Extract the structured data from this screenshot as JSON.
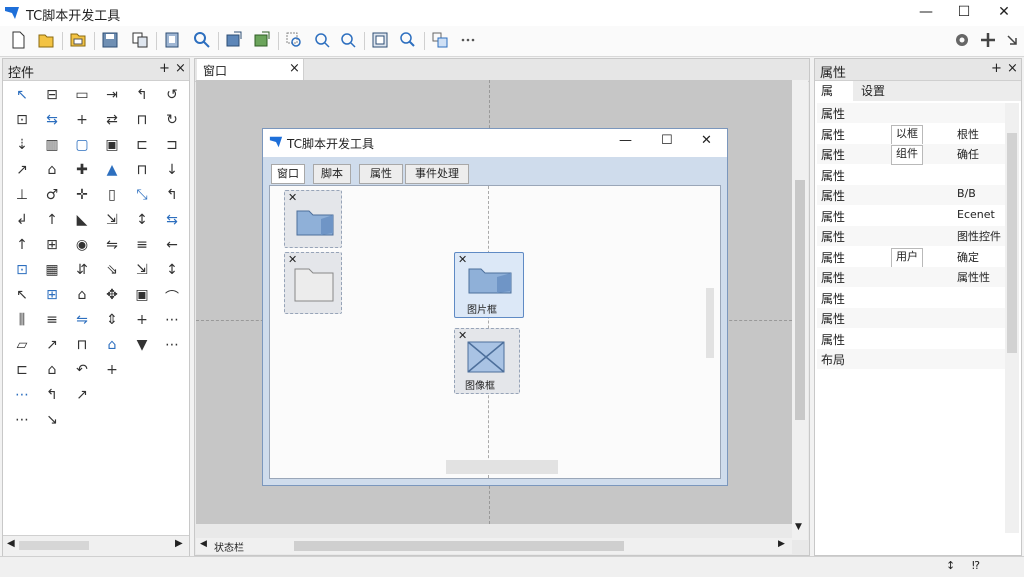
{
  "app": {
    "title": "TC脚本开发工具"
  },
  "window_controls": {
    "minimize": "—",
    "maximize": "☐",
    "close": "✕"
  },
  "left_panel": {
    "title": "控件",
    "pin": "+",
    "close": "×"
  },
  "center": {
    "tab_label": "窗口",
    "tab_close": "×",
    "status": "状态栏",
    "dialog": {
      "title": "TC脚本开发工具",
      "tabs": [
        "窗口",
        "脚本",
        "属性",
        "事件处理"
      ],
      "components": [
        {
          "label": "",
          "icon": "folder-icon"
        },
        {
          "label": "",
          "icon": "folder-outline-icon"
        },
        {
          "label": "图片框",
          "icon": "folder-icon"
        },
        {
          "label": "图像框",
          "icon": "image-placeholder-icon"
        }
      ]
    }
  },
  "right_panel": {
    "title": "属性",
    "pin": "+",
    "close": "×",
    "tabs": [
      "属",
      "设置"
    ],
    "rows": [
      {
        "label": "属性",
        "value": ""
      },
      {
        "label": "属性",
        "value": "以框",
        "extra": "根性"
      },
      {
        "label": "属性",
        "value": "组件",
        "extra": "确任"
      },
      {
        "label": "属性",
        "value": ""
      },
      {
        "label": "属性",
        "value": "",
        "extra": "B/B"
      },
      {
        "label": "属性",
        "value": "",
        "extra": "Ecenet"
      },
      {
        "label": "属性",
        "value": "",
        "extra": "图性控件"
      },
      {
        "label": "属性",
        "value": "用户",
        "extra": "确定"
      },
      {
        "label": "属性",
        "value": "",
        "extra": "属性性"
      },
      {
        "label": "属性",
        "value": ""
      },
      {
        "label": "属性",
        "value": ""
      },
      {
        "label": "属性",
        "value": ""
      },
      {
        "label": "布局",
        "value": ""
      }
    ]
  },
  "colors": {
    "accent": "#1e6fd9",
    "selection": "#cfe0f5",
    "canvas": "#c6c6c6"
  }
}
